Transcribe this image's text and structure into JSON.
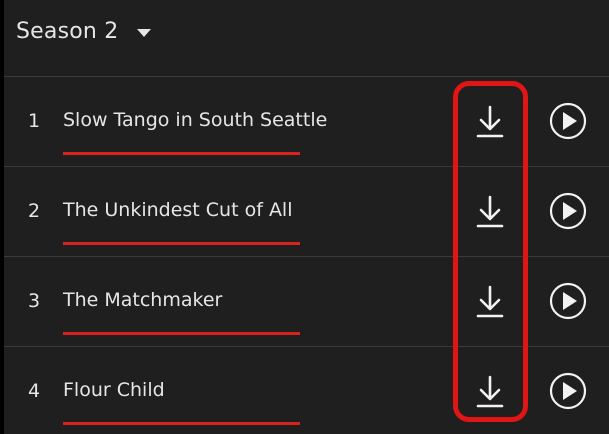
{
  "season_selector": {
    "label": "Season 2",
    "icon": "caret-down-icon"
  },
  "episodes": [
    {
      "number": "1",
      "title": "Slow Tango in South Seattle",
      "progress": 1.0
    },
    {
      "number": "2",
      "title": "The Unkindest Cut of All",
      "progress": 1.0
    },
    {
      "number": "3",
      "title": "The Matchmaker",
      "progress": 1.0
    },
    {
      "number": "4",
      "title": "Flour Child",
      "progress": 1.0
    }
  ],
  "icons": {
    "download": "download-icon",
    "play": "play-circle-icon"
  },
  "colors": {
    "background": "#1f1f1f",
    "text": "#e6e6e6",
    "progress": "#d8221f",
    "highlight": "#e01515"
  }
}
